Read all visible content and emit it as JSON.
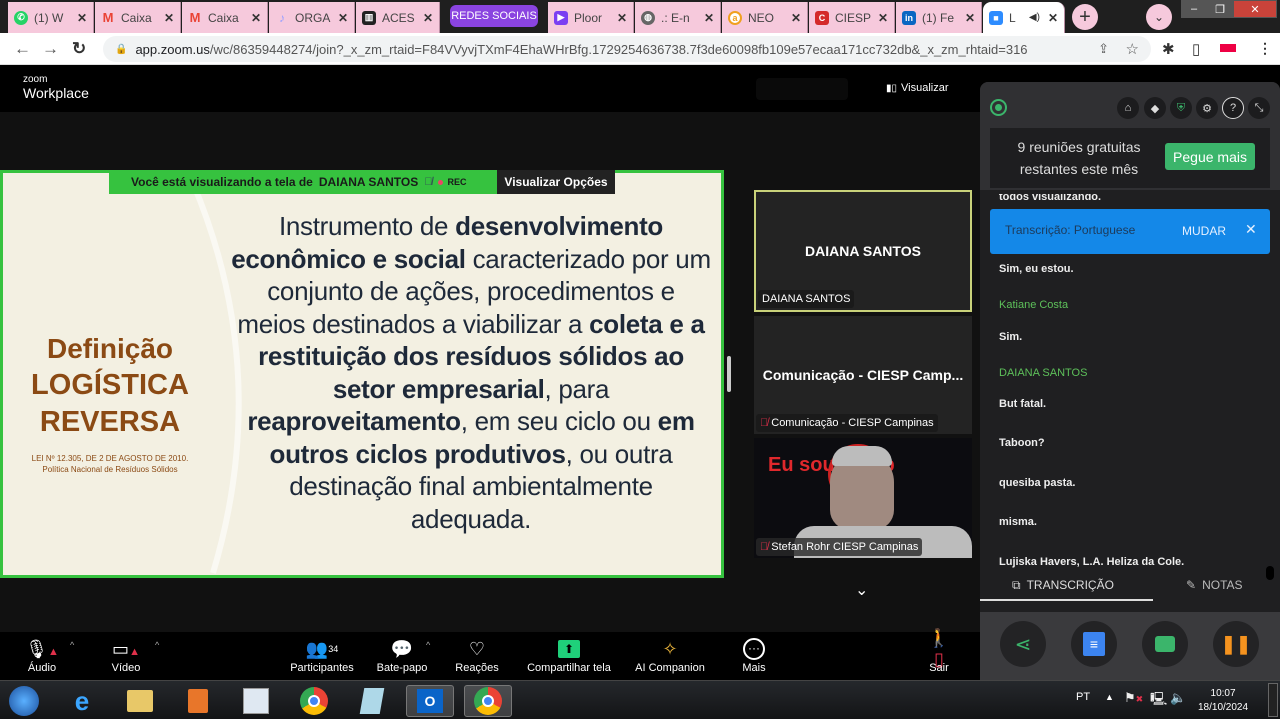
{
  "browser": {
    "tabs": [
      {
        "label": "(1) W",
        "icon": "whatsapp-icon",
        "color": "#25d366"
      },
      {
        "label": "Caixa",
        "icon": "gmail-icon",
        "color": "#ea4335"
      },
      {
        "label": "Caixa",
        "icon": "gmail-icon",
        "color": "#ea4335"
      },
      {
        "label": "ORGA",
        "icon": "orga-icon",
        "color": "#9aa0ff"
      },
      {
        "label": "ACES",
        "icon": "trello-icon",
        "color": "#222222"
      },
      {
        "label": "Ploor",
        "icon": "ploomes-icon",
        "color": "#7b3ff2"
      },
      {
        "label": ".: E-n",
        "icon": "globe-icon",
        "color": "#666666"
      },
      {
        "label": "NEO",
        "icon": "neo-icon",
        "color": "#f0a020"
      },
      {
        "label": "CIESP",
        "icon": "ciesp-icon",
        "color": "#d42a2a"
      },
      {
        "label": "(1) Fe",
        "icon": "linkedin-icon",
        "color": "#0a66c2"
      },
      {
        "label": "L",
        "icon": "zoom-icon",
        "color": "#2d8cff"
      }
    ],
    "tab_group_label": "REDES SOCIAIS",
    "close_glyph": "✕",
    "new_tab_glyph": "+",
    "url_host": "app.zoom.us",
    "url_path": "/wc/86359448274/join?_x_zm_rtaid=F84VVyvjTXmF4EhaWHrBfg.1729254636738.7f3de60098fb109e57ecaa171cc732db&_x_zm_rhtaid=316"
  },
  "zoom": {
    "logo_small": "zoom",
    "logo_big": "Workplace",
    "view_label": "Visualizar",
    "banner": {
      "prefix": "Você está visualizando a tela de",
      "presenter": "DAIANA SANTOS",
      "rec": "REC",
      "view_options": "Visualizar Opções"
    },
    "slide": {
      "title_line1": "Definição",
      "title_line2": "LOGÍSTICA",
      "title_line3": "REVERSA",
      "law_line1": "LEI Nº 12.305, DE 2 DE AGOSTO DE 2010.",
      "law_line2": "Política Nacional de Resíduos Sólidos",
      "body_segments": [
        {
          "text": "Instrumento de ",
          "bold": false
        },
        {
          "text": "desenvolvimento econômico e social",
          "bold": true
        },
        {
          "text": " caracterizado por um conjunto de ações, procedimentos e meios destinados a viabilizar a ",
          "bold": false
        },
        {
          "text": "coleta e a restituição dos resíduos sólidos ao setor empresarial",
          "bold": true
        },
        {
          "text": ", para ",
          "bold": false
        },
        {
          "text": "reaproveitamento",
          "bold": true
        },
        {
          "text": ", em seu ciclo ou ",
          "bold": false
        },
        {
          "text": "em outros ciclos produtivos",
          "bold": true
        },
        {
          "text": ", ou outra destinação final ambientalmente adequada.",
          "bold": false
        }
      ]
    },
    "participants_tiles": [
      {
        "display": "DAIANA SANTOS",
        "label": "DAIANA SANTOS",
        "muted": false
      },
      {
        "display": "Comunicação - CIESP Camp...",
        "label": "Comunicação - CIESP Campinas",
        "muted": true
      },
      {
        "display": "",
        "label": "Stefan Rohr CIESP Campinas",
        "muted": true,
        "background_text": "Eu sou Ciesp"
      }
    ],
    "toolbar": {
      "audio": "Áudio",
      "video": "Vídeo",
      "participants": "Participantes",
      "participants_count": "34",
      "chat": "Bate-papo",
      "reactions": "Reações",
      "share": "Compartilhar tela",
      "ai": "AI Companion",
      "more": "Mais",
      "leave": "Sair"
    }
  },
  "side_panel": {
    "free_meetings_line1": "9 reuniões gratuitas",
    "free_meetings_line2": "restantes este mês",
    "get_more": "Pegue mais",
    "partial_line": "todos visualizando.",
    "transcription_label": "Transcrição: Portuguese",
    "change": "MUDAR",
    "transcript": [
      {
        "type": "text",
        "value": "Sim, eu estou."
      },
      {
        "type": "speaker",
        "value": "Katiane Costa"
      },
      {
        "type": "text",
        "value": "Sim."
      },
      {
        "type": "speaker",
        "value": "DAIANA SANTOS"
      },
      {
        "type": "text",
        "value": "But fatal."
      },
      {
        "type": "text",
        "value": "Taboon?"
      },
      {
        "type": "text",
        "value": "quesiba pasta."
      },
      {
        "type": "text",
        "value": "misma."
      },
      {
        "type": "text",
        "value": "Lujiska Havers, L.A. Heliza da Cole."
      }
    ],
    "tab_transcription": "TRANSCRIÇÃO",
    "tab_notes": "NOTAS"
  },
  "taskbar": {
    "lang": "PT",
    "time": "10:07",
    "date": "18/10/2024"
  }
}
